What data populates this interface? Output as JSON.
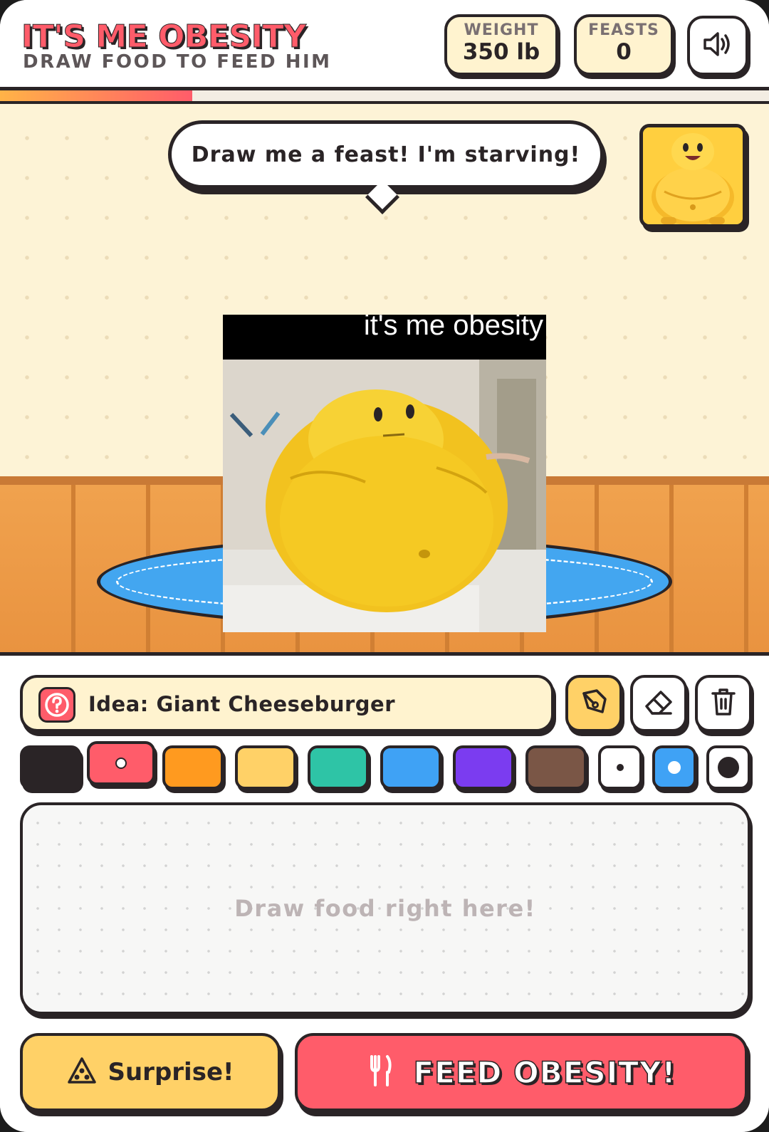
{
  "header": {
    "title": "IT'S ME OBESITY",
    "subtitle": "DRAW FOOD TO FEED HIM",
    "weight_label": "WEIGHT",
    "weight_value": "350 lb",
    "feasts_label": "FEASTS",
    "feasts_value": "0",
    "sound_icon": "speaker-on-icon"
  },
  "progress": {
    "fraction": 0.25,
    "colors": [
      "#ffb347",
      "#ff5c6a"
    ]
  },
  "scene": {
    "speech": "Draw me a feast! I'm starving!",
    "meme_caption": "it's me obesity"
  },
  "tools": {
    "idea_label": "Idea: Giant Cheeseburger",
    "idea_icon": "question-icon",
    "pen_icon": "pen-icon",
    "eraser_icon": "eraser-icon",
    "trash_icon": "trash-icon",
    "active_tool": "pen"
  },
  "palette": {
    "colors": [
      "#2a2426",
      "#ff5c6a",
      "#ff9a1f",
      "#ffd167",
      "#2ec4a6",
      "#3fa2f5",
      "#7b3cf0",
      "#7a5646"
    ],
    "selected_color": "#ff5c6a",
    "brush_sizes": [
      "small",
      "medium",
      "large"
    ],
    "selected_size": "medium"
  },
  "canvas": {
    "placeholder": "Draw food right here!"
  },
  "actions": {
    "surprise_label": "Surprise!",
    "surprise_icon": "pizza-slice-icon",
    "feed_label": "FEED OBESITY!",
    "feed_icon": "fork-knife-icon"
  },
  "accent": {
    "red": "#ff5c6a",
    "yellow": "#ffd167",
    "cream": "#fff3cf",
    "outline": "#2a2426"
  }
}
